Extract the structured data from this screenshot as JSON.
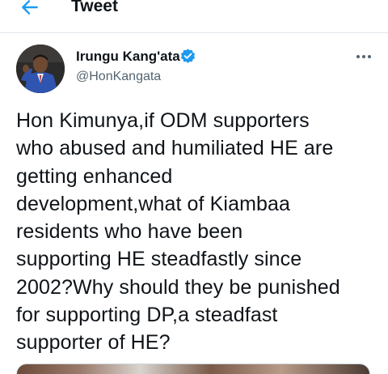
{
  "header": {
    "back_icon": "arrow-left-icon",
    "title": "Tweet"
  },
  "tweet": {
    "author": {
      "name": "Irungu Kang'ata",
      "handle": "@HonKangata",
      "verified_icon": "verified-badge-icon",
      "avatar_icon": "user-avatar"
    },
    "more_icon": "more-options-icon",
    "text": "Hon Kimunya,if ODM supporters\nwho abused and humiliated HE are\ngetting enhanced\ndevelopment,what of Kiambaa\nresidents who have been\nsupporting HE steadfastly since\n2002?Why should they be punished\nfor supporting DP,a steadfast\nsupporter of HE?"
  },
  "colors": {
    "accent": "#1d9bf0",
    "text_primary": "#0f1419",
    "text_secondary": "#536471",
    "divider": "#e1e6ea"
  }
}
